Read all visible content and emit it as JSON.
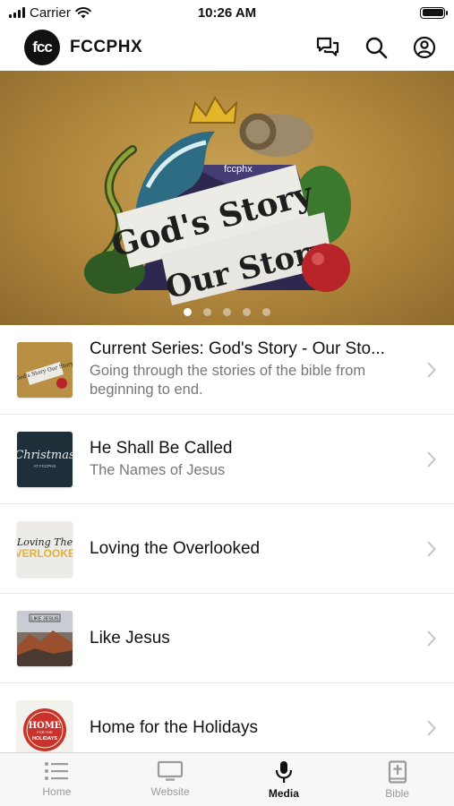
{
  "status_bar": {
    "carrier": "Carrier",
    "time": "10:26 AM"
  },
  "header": {
    "logo_text": "fcc",
    "title": "FCCPHX"
  },
  "hero": {
    "banner_line1": "God's Story",
    "banner_line2": "Our Story",
    "brand_mark": "fccphx",
    "slide_count": 5,
    "active_slide": 1
  },
  "series": [
    {
      "title": "Current Series: God's Story - Our Sto...",
      "subtitle": "Going through the stories of the bible from beginning to end.",
      "thumb_text": "God's Story Our Story",
      "thumb_color": "#b98f45"
    },
    {
      "title": "He Shall Be Called",
      "subtitle": "The Names of Jesus",
      "thumb_text": "Christmas",
      "thumb_sub": "AT FCCPHX",
      "thumb_color": "#1e2f3a"
    },
    {
      "title": "Loving the Overlooked",
      "subtitle": "",
      "thumb_text": "Loving The",
      "thumb_sub": "OVERLOOKED",
      "thumb_color": "#ecebe7"
    },
    {
      "title": "Like Jesus",
      "subtitle": "",
      "thumb_text": "LIKE JESUS",
      "thumb_color": "#7a6e66"
    },
    {
      "title": "Home for the Holidays",
      "subtitle": "",
      "thumb_text": "HOME",
      "thumb_sub": "HOLIDAYS",
      "thumb_mid": "FOR THE",
      "thumb_color": "#c8332d"
    }
  ],
  "tabs": [
    {
      "label": "Home",
      "icon": "list-icon",
      "active": false
    },
    {
      "label": "Website",
      "icon": "monitor-icon",
      "active": false
    },
    {
      "label": "Media",
      "icon": "microphone-icon",
      "active": true
    },
    {
      "label": "Bible",
      "icon": "bible-icon",
      "active": false
    }
  ]
}
